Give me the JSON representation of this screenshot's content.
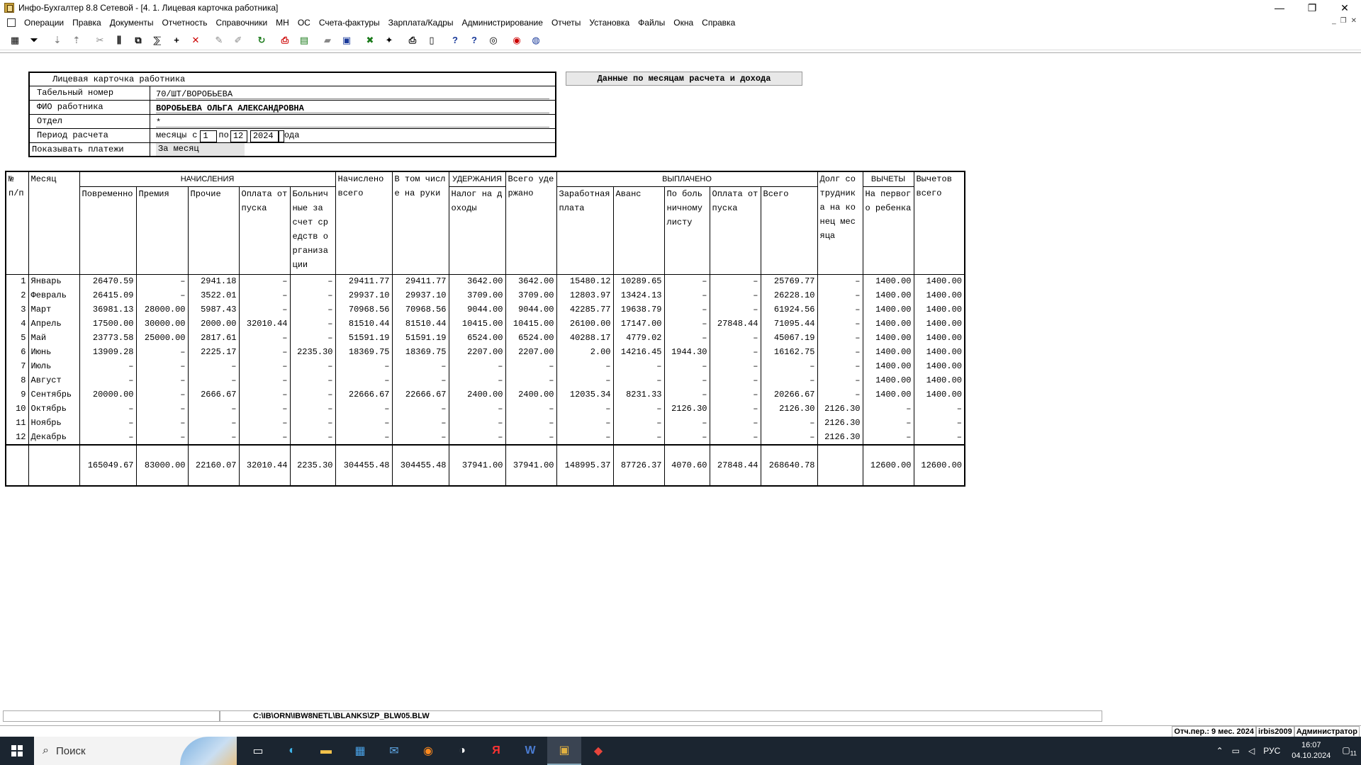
{
  "window": {
    "title": "Инфо-Бухгалтер 8.8 Сетевой - [4. 1. Лицевая карточка работника]",
    "minimize": "—",
    "restore": "❐",
    "close": "✕"
  },
  "menu": {
    "items": [
      "Операции",
      "Правка",
      "Документы",
      "Отчетность",
      "Справочники",
      "МН",
      "ОС",
      "Счета-фактуры",
      "Зарплата/Кадры",
      "Администрирование",
      "Отчеты",
      "Установка",
      "Файлы",
      "Окна",
      "Справка"
    ],
    "mdi_min": "_",
    "mdi_restore": "❐",
    "mdi_close": "✕"
  },
  "toolbar": {
    "buttons": [
      {
        "name": "calculator-icon",
        "glyph": "▦"
      },
      {
        "name": "filter-icon",
        "glyph": "⏷"
      },
      {
        "name": "sort-asc-icon",
        "glyph": "⇣"
      },
      {
        "name": "sort-desc-icon",
        "glyph": "⇡"
      },
      {
        "name": "cut-icon",
        "glyph": "✂"
      },
      {
        "name": "columns-icon",
        "glyph": "⫼"
      },
      {
        "name": "copy-icon",
        "glyph": "⧉"
      },
      {
        "name": "calc-abc-icon",
        "glyph": "⅀"
      },
      {
        "name": "add-icon",
        "glyph": "+"
      },
      {
        "name": "delete-icon",
        "glyph": "✕"
      },
      {
        "name": "mark-icon",
        "glyph": "✎"
      },
      {
        "name": "unmark-icon",
        "glyph": "✐"
      },
      {
        "name": "refresh-icon",
        "glyph": "↻"
      },
      {
        "name": "pdf-icon",
        "glyph": "⎙"
      },
      {
        "name": "table-icon",
        "glyph": "▤"
      },
      {
        "name": "open-folder-icon",
        "glyph": "▰"
      },
      {
        "name": "save-icon",
        "glyph": "▣"
      },
      {
        "name": "excel-icon",
        "glyph": "✖"
      },
      {
        "name": "wizard-icon",
        "glyph": "✦"
      },
      {
        "name": "print-icon",
        "glyph": "⎙"
      },
      {
        "name": "preview-icon",
        "glyph": "▯"
      },
      {
        "name": "help-icon",
        "glyph": "?"
      },
      {
        "name": "context-help-icon",
        "glyph": "?"
      },
      {
        "name": "compass-icon",
        "glyph": "◎"
      },
      {
        "name": "lifebuoy-icon",
        "glyph": "◉"
      },
      {
        "name": "web-icon",
        "glyph": "◍"
      }
    ],
    "colors": {
      "red": "#cc0000",
      "green": "#1a7a1a",
      "blue": "#1a3a9a",
      "gray": "#888888"
    }
  },
  "card": {
    "title": "Лицевая карточка работника",
    "tab_label": "Табельный номер",
    "tab_value": "70/ШТ/ВОРОБЬЕВА",
    "fio_label": "ФИО работника",
    "fio_value": "ВОРОБЬЕВА ОЛЬГА АЛЕКСАНДРОВНА",
    "dept_label": "Отдел",
    "dept_value": "*",
    "period_label": "Период расчета",
    "period_months": "месяцы",
    "period_from_label": "с",
    "period_from": "1",
    "period_to_label": "по",
    "period_to": "12",
    "period_year": "2024",
    "period_year_suffix": "ода",
    "show_label": "Показывать платежи",
    "show_value": "За месяц"
  },
  "months_button": "Данные по месяцам расчета и дохода",
  "table": {
    "group_headers": {
      "num": "№ п/п",
      "month": "Месяц",
      "accruals": "НАЧИСЛЕНИЯ",
      "accrued_total": "Начислено всего",
      "in_hand": "В том числе на руки",
      "withholdings": "УДЕРЖАНИЯ",
      "withheld_total": "Всего удержано",
      "paid": "ВЫПЛАЧЕНО",
      "debt": "Долг со трудника на конец месяца",
      "deductions": "ВЫЧЕТЫ",
      "deductions_total": "Вычетов всего"
    },
    "sub_headers": {
      "time": "Повременно",
      "bonus": "Премия",
      "other": "Прочие",
      "vacation": "Оплата отпуска",
      "sick": "Больничные за счет средств организации",
      "tax": "Налог на доходы",
      "salary": "Заработная плата",
      "advance": "Аванс",
      "sick_paid": "По больничному листу",
      "vacation_paid": "Оплата отпуска",
      "paid_total": "Всего",
      "first_child": "На первого ребенка"
    },
    "rows": [
      [
        "1",
        "Январь",
        "26470.59",
        "–",
        "2941.18",
        "–",
        "–",
        "29411.77",
        "29411.77",
        "3642.00",
        "3642.00",
        "15480.12",
        "10289.65",
        "–",
        "–",
        "25769.77",
        "–",
        "1400.00",
        "1400.00"
      ],
      [
        "2",
        "Февраль",
        "26415.09",
        "–",
        "3522.01",
        "–",
        "–",
        "29937.10",
        "29937.10",
        "3709.00",
        "3709.00",
        "12803.97",
        "13424.13",
        "–",
        "–",
        "26228.10",
        "–",
        "1400.00",
        "1400.00"
      ],
      [
        "3",
        "Март",
        "36981.13",
        "28000.00",
        "5987.43",
        "–",
        "–",
        "70968.56",
        "70968.56",
        "9044.00",
        "9044.00",
        "42285.77",
        "19638.79",
        "–",
        "–",
        "61924.56",
        "–",
        "1400.00",
        "1400.00"
      ],
      [
        "4",
        "Апрель",
        "17500.00",
        "30000.00",
        "2000.00",
        "32010.44",
        "–",
        "81510.44",
        "81510.44",
        "10415.00",
        "10415.00",
        "26100.00",
        "17147.00",
        "–",
        "27848.44",
        "71095.44",
        "–",
        "1400.00",
        "1400.00"
      ],
      [
        "5",
        "Май",
        "23773.58",
        "25000.00",
        "2817.61",
        "–",
        "–",
        "51591.19",
        "51591.19",
        "6524.00",
        "6524.00",
        "40288.17",
        "4779.02",
        "–",
        "–",
        "45067.19",
        "–",
        "1400.00",
        "1400.00"
      ],
      [
        "6",
        "Июнь",
        "13909.28",
        "–",
        "2225.17",
        "–",
        "2235.30",
        "18369.75",
        "18369.75",
        "2207.00",
        "2207.00",
        "2.00",
        "14216.45",
        "1944.30",
        "–",
        "16162.75",
        "–",
        "1400.00",
        "1400.00"
      ],
      [
        "7",
        "Июль",
        "–",
        "–",
        "–",
        "–",
        "–",
        "–",
        "–",
        "–",
        "–",
        "–",
        "–",
        "–",
        "–",
        "–",
        "–",
        "1400.00",
        "1400.00"
      ],
      [
        "8",
        "Август",
        "–",
        "–",
        "–",
        "–",
        "–",
        "–",
        "–",
        "–",
        "–",
        "–",
        "–",
        "–",
        "–",
        "–",
        "–",
        "1400.00",
        "1400.00"
      ],
      [
        "9",
        "Сентябрь",
        "20000.00",
        "–",
        "2666.67",
        "–",
        "–",
        "22666.67",
        "22666.67",
        "2400.00",
        "2400.00",
        "12035.34",
        "8231.33",
        "–",
        "–",
        "20266.67",
        "–",
        "1400.00",
        "1400.00"
      ],
      [
        "10",
        "Октябрь",
        "–",
        "–",
        "–",
        "–",
        "–",
        "–",
        "–",
        "–",
        "–",
        "–",
        "–",
        "2126.30",
        "–",
        "2126.30",
        "2126.30",
        "–",
        "–"
      ],
      [
        "11",
        "Ноябрь",
        "–",
        "–",
        "–",
        "–",
        "–",
        "–",
        "–",
        "–",
        "–",
        "–",
        "–",
        "–",
        "–",
        "–",
        "2126.30",
        "–",
        "–"
      ],
      [
        "12",
        "Декабрь",
        "–",
        "–",
        "–",
        "–",
        "–",
        "–",
        "–",
        "–",
        "–",
        "–",
        "–",
        "–",
        "–",
        "–",
        "2126.30",
        "–",
        "–"
      ]
    ],
    "totals": [
      "",
      "",
      "165049.67",
      "83000.00",
      "22160.07",
      "32010.44",
      "2235.30",
      "304455.48",
      "304455.48",
      "37941.00",
      "37941.00",
      "148995.37",
      "87726.37",
      "4070.60",
      "27848.44",
      "268640.78",
      "",
      "12600.00",
      "12600.00"
    ]
  },
  "status": {
    "path": "C:\\IB\\ORN\\IBW8NETL\\BLANKS\\ZP_BLW05.BLW",
    "period": "Отч.пер.: 9 мес. 2024",
    "db": "irbis2009",
    "user": "Администратор"
  },
  "taskbar": {
    "search_placeholder": "Поиск",
    "lang": "РУС",
    "time": "16:07",
    "date": "04.10.2024",
    "notifications": "11"
  }
}
